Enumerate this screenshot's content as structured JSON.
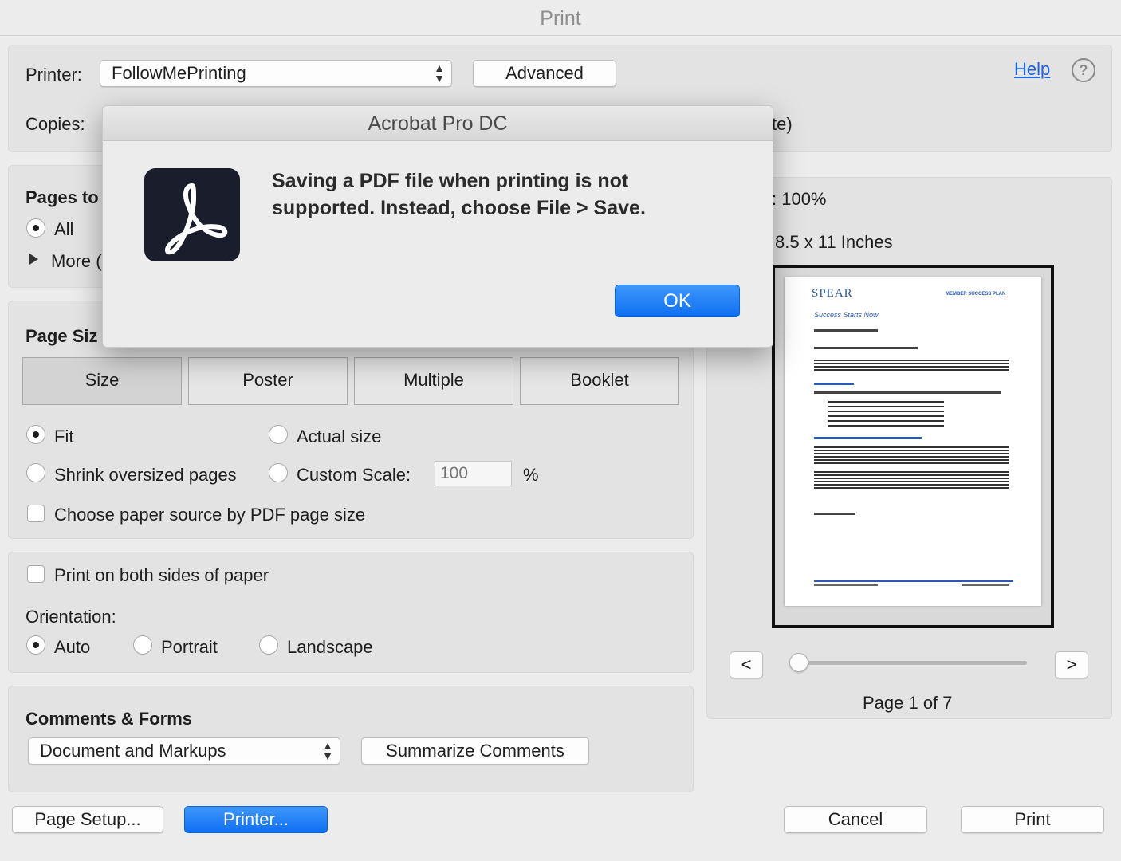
{
  "window": {
    "title": "Print"
  },
  "printer": {
    "label": "Printer:",
    "value": "FollowMePrinting",
    "advanced_label": "Advanced",
    "help_label": "Help",
    "help_icon": "?"
  },
  "copies": {
    "label": "Copies:",
    "hidden_suffix": "te)"
  },
  "pages_to_print": {
    "heading": "Pages to",
    "all_label": "All",
    "more_label": "More ("
  },
  "page_sizing": {
    "heading": "Page Siz",
    "tabs": [
      "Size",
      "Poster",
      "Multiple",
      "Booklet"
    ],
    "fit_label": "Fit",
    "actual_size_label": "Actual size",
    "shrink_label": "Shrink oversized pages",
    "custom_scale_label": "Custom Scale:",
    "custom_scale_placeholder": "100",
    "percent": "%",
    "paper_source_label": "Choose paper source by PDF page size"
  },
  "duplex": {
    "label": "Print on both sides of paper"
  },
  "orientation": {
    "label": "Orientation:",
    "auto": "Auto",
    "portrait": "Portrait",
    "landscape": "Landscape"
  },
  "comments_forms": {
    "heading": "Comments & Forms",
    "value": "Document and Markups",
    "summarize_label": "Summarize Comments"
  },
  "preview": {
    "scale_text": ": 100%",
    "size_text": "8.5 x 11 Inches",
    "prev_label": "<",
    "next_label": ">",
    "page_text": "Page 1 of 7",
    "slider_fraction": 0,
    "doc_logo": "SPEAR",
    "doc_header": "MEMBER SUCCESS PLAN",
    "doc_subtitle": "Success Starts Now"
  },
  "footer": {
    "page_setup": "Page Setup...",
    "printer": "Printer...",
    "cancel": "Cancel",
    "print": "Print"
  },
  "alert": {
    "title": "Acrobat Pro DC",
    "message_line1": "Saving a PDF file when printing is not",
    "message_line2": "supported. Instead, choose File > Save.",
    "ok_label": "OK",
    "accent_color": "#1a1d2b"
  }
}
